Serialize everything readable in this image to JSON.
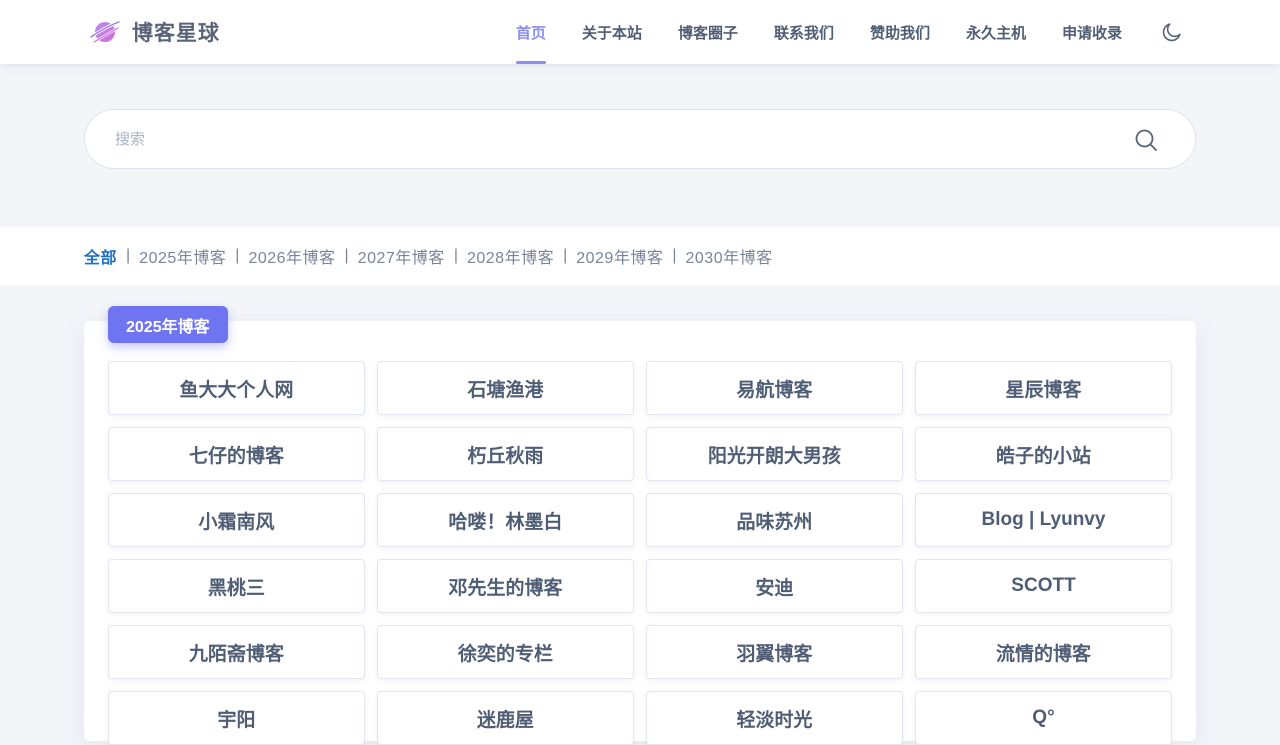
{
  "site": {
    "title": "博客星球"
  },
  "nav": {
    "items": [
      "首页",
      "关于本站",
      "博客圈子",
      "联系我们",
      "赞助我们",
      "永久主机",
      "申请收录"
    ],
    "active_index": 0
  },
  "search": {
    "placeholder": "搜索"
  },
  "filters": {
    "items": [
      "全部",
      "2025年博客",
      "2026年博客",
      "2027年博客",
      "2028年博客",
      "2029年博客",
      "2030年博客"
    ],
    "active_index": 0,
    "separator": "|"
  },
  "section": {
    "tag": "2025年博客",
    "blogs": [
      "鱼大大个人网",
      "石塘渔港",
      "易航博客",
      "星辰博客",
      "七仔的博客",
      "朽丘秋雨",
      "阳光开朗大男孩",
      "皓子的小站",
      "小霜南风",
      "哈喽！林墨白",
      "品味苏州",
      "Blog | Lyunvy",
      "黑桃三",
      "邓先生的博客",
      "安迪",
      "SCOTT",
      "九陌斋博客",
      "徐奕的专栏",
      "羽翼博客",
      "流情的博客",
      "宇阳",
      "迷鹿屋",
      "轻淡时光",
      "Q°"
    ]
  },
  "icons": {
    "logo": "planet-logo-icon",
    "theme": "moon-icon",
    "search": "search-icon"
  },
  "colors": {
    "accent": "#6f75f0",
    "nav_active": "#8a8ff0",
    "filter_active": "#1f6fc7",
    "background": "#f3f5f9"
  }
}
